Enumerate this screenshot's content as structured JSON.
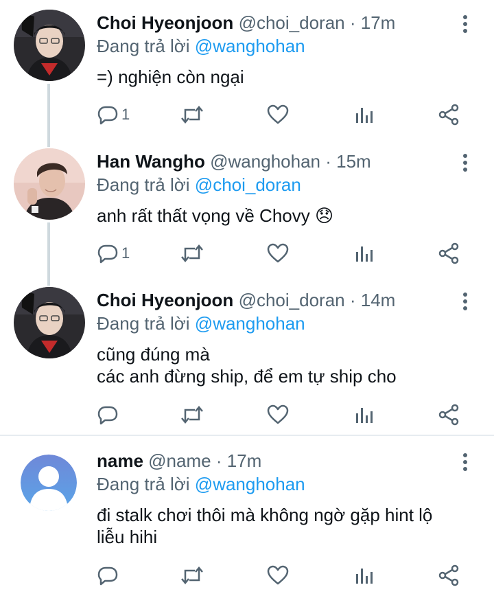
{
  "tweets": [
    {
      "name": "Choi Hyeonjoon",
      "handle": "@choi_doran",
      "sep": "·",
      "time": "17m",
      "reply_prefix": "Đang trả lời",
      "reply_to": "@wanghohan",
      "text_lines": [
        "=) nghiện còn ngại"
      ],
      "reply_count": "1",
      "avatar": "doran-avatar"
    },
    {
      "name": "Han Wangho",
      "handle": "@wanghohan",
      "sep": "·",
      "time": "15m",
      "reply_prefix": "Đang trả lời",
      "reply_to": "@choi_doran",
      "text_lines": [
        "anh rất thất vọng về Chovy"
      ],
      "emoji": "😞",
      "reply_count": "1",
      "avatar": "wangho-avatar"
    },
    {
      "name": "Choi Hyeonjoon",
      "handle": "@choi_doran",
      "sep": "·",
      "time": "14m",
      "reply_prefix": "Đang trả lời",
      "reply_to": "@wanghohan",
      "text_lines": [
        "cũng đúng mà",
        "các anh đừng ship, để em tự ship cho"
      ],
      "reply_count": "",
      "avatar": "doran-avatar"
    },
    {
      "name": "name",
      "handle": "@name",
      "sep": "·",
      "time": "17m",
      "reply_prefix": "Đang trả lời",
      "reply_to": "@wanghohan",
      "text_lines": [
        "đi stalk chơi thôi mà không ngờ gặp hint lộ",
        "liễu hihi"
      ],
      "reply_count": "",
      "avatar": "default-avatar"
    }
  ],
  "colors": {
    "accent": "#1d9bf0",
    "secondary_text": "#536471",
    "icon": "#536471",
    "thread_line": "#cfd9de"
  }
}
